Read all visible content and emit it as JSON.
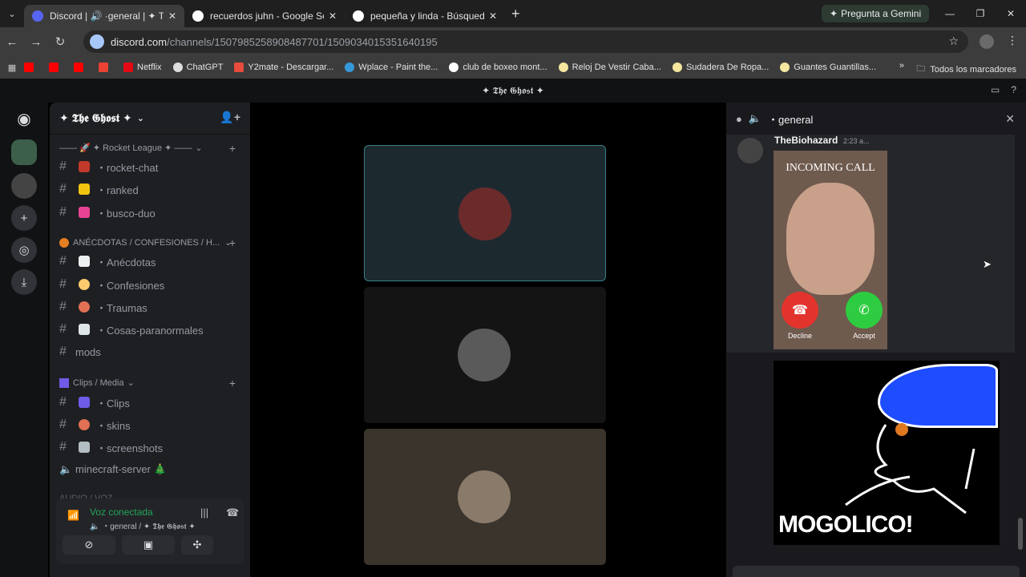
{
  "browser": {
    "tabs": [
      {
        "title": "Discord | 🔊 ·general | ✦ The G",
        "active": true,
        "favicon_color": "#5865f2"
      },
      {
        "title": "recuerdos juhn - Google Search",
        "active": false,
        "favicon_color": "#ffffff"
      },
      {
        "title": "pequeña y linda - Búsqueda de",
        "active": false,
        "favicon_color": "#ffffff"
      }
    ],
    "gemini_label": "Pregunta a Gemini",
    "url_host": "discord.com",
    "url_path": "/channels/1507985258908487701/1509034015351640195",
    "bookmarks": [
      "Netflix",
      "ChatGPT",
      "Y2mate - Descargar...",
      "Wplace - Paint the...",
      "club de boxeo mont...",
      "Reloj De Vestir Caba...",
      "Sudadera De Ropa...",
      "Guantes Guantillas..."
    ],
    "all_bookmarks": "Todos los marcadores"
  },
  "discord": {
    "top_title": "✦ 𝕿𝖍𝖊 𝕲𝖍𝖔𝖘𝖙 ✦",
    "guild_name": "✦ 𝕿𝖍𝖊 𝕲𝖍𝖔𝖘𝖙 ✦",
    "categories": [
      {
        "label": "—— 🚀 ✦ Rocket League ✦ ——"
      },
      {
        "label": "ANÉCDOTAS / CONFESIONES / H..."
      },
      {
        "label": "Clips / Media"
      },
      {
        "label": "AUDIO / VOZ"
      }
    ],
    "channels": [
      {
        "label": "・rocket-chat",
        "emoji_color": "#c0392b"
      },
      {
        "label": "・ranked",
        "emoji_color": "#f1c40f"
      },
      {
        "label": "・busco-duo",
        "emoji_color": "#e84393"
      },
      {
        "label": "・Anécdotas",
        "emoji_color": "#ecf0f1"
      },
      {
        "label": "・Confesiones",
        "emoji_color": "#fdcb6e"
      },
      {
        "label": "・Traumas",
        "emoji_color": "#e17055"
      },
      {
        "label": "・Cosas-paranormales",
        "emoji_color": "#dfe6e9"
      },
      {
        "label": "mods",
        "emoji_color": ""
      },
      {
        "label": "・Clips",
        "emoji_color": "#6c5ce7"
      },
      {
        "label": "・skins",
        "emoji_color": "#e17055"
      },
      {
        "label": "・screenshots",
        "emoji_color": "#b2bec3"
      },
      {
        "label": "minecraft-server 🎄",
        "emoji_color": ""
      }
    ],
    "voice": {
      "status": "Voz conectada",
      "channel": "・general / ✦ 𝕿𝖍𝖊 𝕲𝖍𝖔𝖘𝖙 ✦"
    },
    "chat": {
      "channel": "・general",
      "author": "TheBiohazard",
      "time": "2:23 a...",
      "call_title": "INCOMING CALL",
      "decline": "Decline",
      "accept": "Accept",
      "meme_text": "MOGOLICO!"
    }
  },
  "colors": {
    "discord_green": "#23a55a",
    "decline_red": "#e2342d",
    "accept_green": "#2ecc40",
    "hat_blue": "#1e4cff"
  }
}
